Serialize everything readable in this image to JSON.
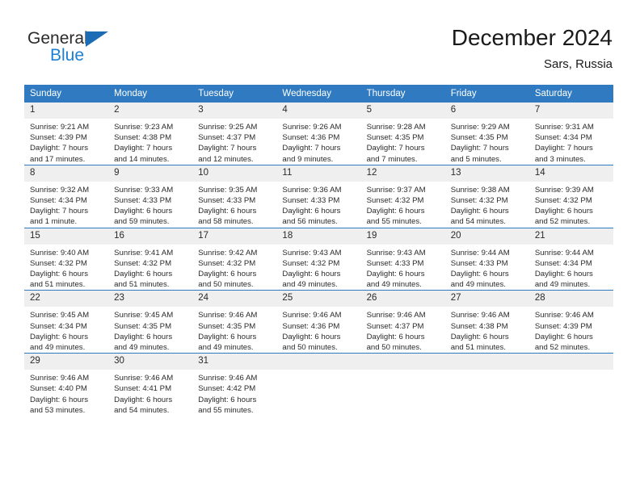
{
  "brand": {
    "name_top": "General",
    "name_bottom": "Blue",
    "triangle_color": "#1b6cb5",
    "blue_color": "#1b7fd4"
  },
  "header": {
    "title": "December 2024",
    "location": "Sars, Russia"
  },
  "theme": {
    "header_blue": "#2f7ac0",
    "daynum_background": "#efefef",
    "text_color": "#2a2a2a"
  },
  "weekday_headers": [
    "Sunday",
    "Monday",
    "Tuesday",
    "Wednesday",
    "Thursday",
    "Friday",
    "Saturday"
  ],
  "weeks": [
    [
      {
        "day": "1",
        "sunrise": "Sunrise: 9:21 AM",
        "sunset": "Sunset: 4:39 PM",
        "daylight_line1": "Daylight: 7 hours",
        "daylight_line2": "and 17 minutes."
      },
      {
        "day": "2",
        "sunrise": "Sunrise: 9:23 AM",
        "sunset": "Sunset: 4:38 PM",
        "daylight_line1": "Daylight: 7 hours",
        "daylight_line2": "and 14 minutes."
      },
      {
        "day": "3",
        "sunrise": "Sunrise: 9:25 AM",
        "sunset": "Sunset: 4:37 PM",
        "daylight_line1": "Daylight: 7 hours",
        "daylight_line2": "and 12 minutes."
      },
      {
        "day": "4",
        "sunrise": "Sunrise: 9:26 AM",
        "sunset": "Sunset: 4:36 PM",
        "daylight_line1": "Daylight: 7 hours",
        "daylight_line2": "and 9 minutes."
      },
      {
        "day": "5",
        "sunrise": "Sunrise: 9:28 AM",
        "sunset": "Sunset: 4:35 PM",
        "daylight_line1": "Daylight: 7 hours",
        "daylight_line2": "and 7 minutes."
      },
      {
        "day": "6",
        "sunrise": "Sunrise: 9:29 AM",
        "sunset": "Sunset: 4:35 PM",
        "daylight_line1": "Daylight: 7 hours",
        "daylight_line2": "and 5 minutes."
      },
      {
        "day": "7",
        "sunrise": "Sunrise: 9:31 AM",
        "sunset": "Sunset: 4:34 PM",
        "daylight_line1": "Daylight: 7 hours",
        "daylight_line2": "and 3 minutes."
      }
    ],
    [
      {
        "day": "8",
        "sunrise": "Sunrise: 9:32 AM",
        "sunset": "Sunset: 4:34 PM",
        "daylight_line1": "Daylight: 7 hours",
        "daylight_line2": "and 1 minute."
      },
      {
        "day": "9",
        "sunrise": "Sunrise: 9:33 AM",
        "sunset": "Sunset: 4:33 PM",
        "daylight_line1": "Daylight: 6 hours",
        "daylight_line2": "and 59 minutes."
      },
      {
        "day": "10",
        "sunrise": "Sunrise: 9:35 AM",
        "sunset": "Sunset: 4:33 PM",
        "daylight_line1": "Daylight: 6 hours",
        "daylight_line2": "and 58 minutes."
      },
      {
        "day": "11",
        "sunrise": "Sunrise: 9:36 AM",
        "sunset": "Sunset: 4:33 PM",
        "daylight_line1": "Daylight: 6 hours",
        "daylight_line2": "and 56 minutes."
      },
      {
        "day": "12",
        "sunrise": "Sunrise: 9:37 AM",
        "sunset": "Sunset: 4:32 PM",
        "daylight_line1": "Daylight: 6 hours",
        "daylight_line2": "and 55 minutes."
      },
      {
        "day": "13",
        "sunrise": "Sunrise: 9:38 AM",
        "sunset": "Sunset: 4:32 PM",
        "daylight_line1": "Daylight: 6 hours",
        "daylight_line2": "and 54 minutes."
      },
      {
        "day": "14",
        "sunrise": "Sunrise: 9:39 AM",
        "sunset": "Sunset: 4:32 PM",
        "daylight_line1": "Daylight: 6 hours",
        "daylight_line2": "and 52 minutes."
      }
    ],
    [
      {
        "day": "15",
        "sunrise": "Sunrise: 9:40 AM",
        "sunset": "Sunset: 4:32 PM",
        "daylight_line1": "Daylight: 6 hours",
        "daylight_line2": "and 51 minutes."
      },
      {
        "day": "16",
        "sunrise": "Sunrise: 9:41 AM",
        "sunset": "Sunset: 4:32 PM",
        "daylight_line1": "Daylight: 6 hours",
        "daylight_line2": "and 51 minutes."
      },
      {
        "day": "17",
        "sunrise": "Sunrise: 9:42 AM",
        "sunset": "Sunset: 4:32 PM",
        "daylight_line1": "Daylight: 6 hours",
        "daylight_line2": "and 50 minutes."
      },
      {
        "day": "18",
        "sunrise": "Sunrise: 9:43 AM",
        "sunset": "Sunset: 4:32 PM",
        "daylight_line1": "Daylight: 6 hours",
        "daylight_line2": "and 49 minutes."
      },
      {
        "day": "19",
        "sunrise": "Sunrise: 9:43 AM",
        "sunset": "Sunset: 4:33 PM",
        "daylight_line1": "Daylight: 6 hours",
        "daylight_line2": "and 49 minutes."
      },
      {
        "day": "20",
        "sunrise": "Sunrise: 9:44 AM",
        "sunset": "Sunset: 4:33 PM",
        "daylight_line1": "Daylight: 6 hours",
        "daylight_line2": "and 49 minutes."
      },
      {
        "day": "21",
        "sunrise": "Sunrise: 9:44 AM",
        "sunset": "Sunset: 4:34 PM",
        "daylight_line1": "Daylight: 6 hours",
        "daylight_line2": "and 49 minutes."
      }
    ],
    [
      {
        "day": "22",
        "sunrise": "Sunrise: 9:45 AM",
        "sunset": "Sunset: 4:34 PM",
        "daylight_line1": "Daylight: 6 hours",
        "daylight_line2": "and 49 minutes."
      },
      {
        "day": "23",
        "sunrise": "Sunrise: 9:45 AM",
        "sunset": "Sunset: 4:35 PM",
        "daylight_line1": "Daylight: 6 hours",
        "daylight_line2": "and 49 minutes."
      },
      {
        "day": "24",
        "sunrise": "Sunrise: 9:46 AM",
        "sunset": "Sunset: 4:35 PM",
        "daylight_line1": "Daylight: 6 hours",
        "daylight_line2": "and 49 minutes."
      },
      {
        "day": "25",
        "sunrise": "Sunrise: 9:46 AM",
        "sunset": "Sunset: 4:36 PM",
        "daylight_line1": "Daylight: 6 hours",
        "daylight_line2": "and 50 minutes."
      },
      {
        "day": "26",
        "sunrise": "Sunrise: 9:46 AM",
        "sunset": "Sunset: 4:37 PM",
        "daylight_line1": "Daylight: 6 hours",
        "daylight_line2": "and 50 minutes."
      },
      {
        "day": "27",
        "sunrise": "Sunrise: 9:46 AM",
        "sunset": "Sunset: 4:38 PM",
        "daylight_line1": "Daylight: 6 hours",
        "daylight_line2": "and 51 minutes."
      },
      {
        "day": "28",
        "sunrise": "Sunrise: 9:46 AM",
        "sunset": "Sunset: 4:39 PM",
        "daylight_line1": "Daylight: 6 hours",
        "daylight_line2": "and 52 minutes."
      }
    ],
    [
      {
        "day": "29",
        "sunrise": "Sunrise: 9:46 AM",
        "sunset": "Sunset: 4:40 PM",
        "daylight_line1": "Daylight: 6 hours",
        "daylight_line2": "and 53 minutes."
      },
      {
        "day": "30",
        "sunrise": "Sunrise: 9:46 AM",
        "sunset": "Sunset: 4:41 PM",
        "daylight_line1": "Daylight: 6 hours",
        "daylight_line2": "and 54 minutes."
      },
      {
        "day": "31",
        "sunrise": "Sunrise: 9:46 AM",
        "sunset": "Sunset: 4:42 PM",
        "daylight_line1": "Daylight: 6 hours",
        "daylight_line2": "and 55 minutes."
      },
      {
        "day": "",
        "sunrise": "",
        "sunset": "",
        "daylight_line1": "",
        "daylight_line2": ""
      },
      {
        "day": "",
        "sunrise": "",
        "sunset": "",
        "daylight_line1": "",
        "daylight_line2": ""
      },
      {
        "day": "",
        "sunrise": "",
        "sunset": "",
        "daylight_line1": "",
        "daylight_line2": ""
      },
      {
        "day": "",
        "sunrise": "",
        "sunset": "",
        "daylight_line1": "",
        "daylight_line2": ""
      }
    ]
  ]
}
